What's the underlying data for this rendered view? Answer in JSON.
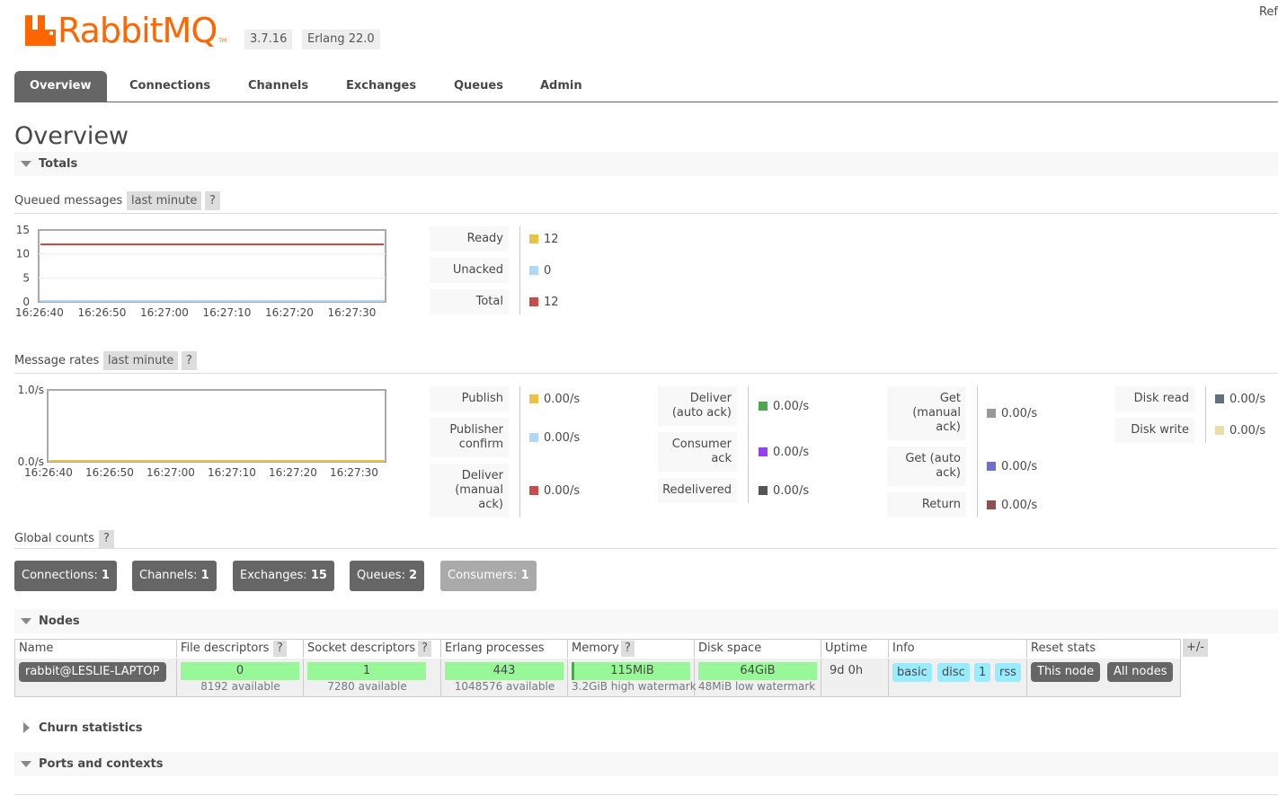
{
  "header": {
    "logo_text": "RabbitMQ",
    "logo_tm": "TM",
    "version": "3.7.16",
    "erlang": "Erlang 22.0",
    "refresh": "Ref"
  },
  "tabs": [
    "Overview",
    "Connections",
    "Channels",
    "Exchanges",
    "Queues",
    "Admin"
  ],
  "page_title": "Overview",
  "totals": {
    "section_label": "Totals",
    "queued": {
      "label": "Queued messages",
      "range": "last minute",
      "help": "?",
      "legend": [
        {
          "label": "Ready",
          "value": "12",
          "color": "#edc240"
        },
        {
          "label": "Unacked",
          "value": "0",
          "color": "#afd8f8"
        },
        {
          "label": "Total",
          "value": "12",
          "color": "#cb4b4b"
        }
      ]
    },
    "rates": {
      "label": "Message rates",
      "range": "last minute",
      "help": "?",
      "col1": [
        {
          "label": "Publish",
          "value": "0.00/s",
          "color": "#edc240"
        },
        {
          "label": "Publisher confirm",
          "value": "0.00/s",
          "color": "#afd8f8"
        },
        {
          "label": "Deliver (manual ack)",
          "value": "0.00/s",
          "color": "#cb4b4b"
        }
      ],
      "col2": [
        {
          "label": "Deliver (auto ack)",
          "value": "0.00/s",
          "color": "#4da74d"
        },
        {
          "label": "Consumer ack",
          "value": "0.00/s",
          "color": "#9440ed"
        },
        {
          "label": "Redelivered",
          "value": "0.00/s",
          "color": "#555555"
        }
      ],
      "col3": [
        {
          "label": "Get (manual ack)",
          "value": "0.00/s",
          "color": "#999999"
        },
        {
          "label": "Get (auto ack)",
          "value": "0.00/s",
          "color": "#7070cc"
        },
        {
          "label": "Return",
          "value": "0.00/s",
          "color": "#905050"
        }
      ],
      "col4": [
        {
          "label": "Disk read",
          "value": "0.00/s",
          "color": "#607080"
        },
        {
          "label": "Disk write",
          "value": "0.00/s",
          "color": "#e8e0a8"
        }
      ]
    }
  },
  "chart_data": [
    {
      "type": "line",
      "title": "Queued messages",
      "x": [
        "16:26:40",
        "16:26:50",
        "16:27:00",
        "16:27:10",
        "16:27:20",
        "16:27:30"
      ],
      "yticks": [
        "15",
        "10",
        "5",
        "0"
      ],
      "ylim": [
        0,
        15
      ],
      "series": [
        {
          "name": "Ready",
          "values": [
            12,
            12,
            12,
            12,
            12,
            12
          ],
          "color": "#edc240"
        },
        {
          "name": "Unacked",
          "values": [
            0,
            0,
            0,
            0,
            0,
            0
          ],
          "color": "#afd8f8"
        },
        {
          "name": "Total",
          "values": [
            12,
            12,
            12,
            12,
            12,
            12
          ],
          "color": "#cb4b4b"
        }
      ]
    },
    {
      "type": "line",
      "title": "Message rates",
      "x": [
        "16:26:40",
        "16:26:50",
        "16:27:00",
        "16:27:10",
        "16:27:20",
        "16:27:30"
      ],
      "yticks": [
        "1.0/s",
        "0.0/s"
      ],
      "ylim": [
        0,
        1
      ],
      "series": [
        {
          "name": "Publish",
          "values": [
            0,
            0,
            0,
            0,
            0,
            0
          ],
          "color": "#edc240"
        }
      ]
    }
  ],
  "global_counts": {
    "label": "Global counts",
    "help": "?",
    "items": [
      {
        "label": "Connections:",
        "value": "1"
      },
      {
        "label": "Channels:",
        "value": "1"
      },
      {
        "label": "Exchanges:",
        "value": "15"
      },
      {
        "label": "Queues:",
        "value": "2"
      },
      {
        "label": "Consumers:",
        "value": "1"
      }
    ]
  },
  "nodes": {
    "section_label": "Nodes",
    "help": "?",
    "columns": [
      "Name",
      "File descriptors",
      "Socket descriptors",
      "Erlang processes",
      "Memory",
      "Disk space",
      "Uptime",
      "Info",
      "Reset stats"
    ],
    "plus_minus": "+/-",
    "row": {
      "name": "rabbit@LESLIE-LAPTOP",
      "fd": "0",
      "fd_sub": "8192 available",
      "sd": "1",
      "sd_sub": "7280 available",
      "ep": "443",
      "ep_sub": "1048576 available",
      "mem": "115MiB",
      "mem_sub": "3.2GiB high watermark",
      "disk": "64GiB",
      "disk_sub": "48MiB low watermark",
      "uptime": "9d 0h",
      "info": [
        "basic",
        "disc",
        "1",
        "rss"
      ],
      "reset_this": "This node",
      "reset_all": "All nodes"
    }
  },
  "churn": {
    "section_label": "Churn statistics"
  },
  "ports": {
    "section_label": "Ports and contexts"
  }
}
